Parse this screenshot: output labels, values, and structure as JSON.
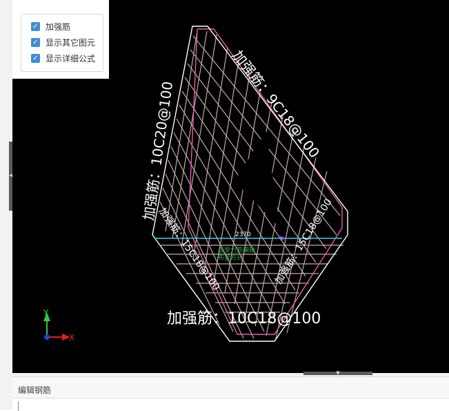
{
  "options_panel": {
    "items": [
      {
        "label": "加强筋",
        "checked": true
      },
      {
        "label": "显示其它图元",
        "checked": true
      },
      {
        "label": "显示详细公式",
        "checked": true
      }
    ]
  },
  "drawing": {
    "labels": {
      "top_right": "加强筋：9C18@100",
      "left": "加强筋：10C20@100",
      "bottom": "加强筋：10C18@100",
      "lower_left": "加强筋：15C18@100",
      "lower_right": "加强筋：15C18@100",
      "dimension": "2370",
      "green_text_1": "板受力筋编辑",
      "green_text_2": "布置方式"
    },
    "axis": {
      "y": "Y",
      "x": "X"
    },
    "colors": {
      "background": "#000000",
      "outline": "#ffffff",
      "rebar_lines": "#c8a9a9",
      "edge_rebar": "#e060b0",
      "dimension_line": "#38d0e8",
      "axis_y": "#2ecc40",
      "axis_x": "#e02020"
    }
  },
  "bottom_panel": {
    "title": "编辑钢筋"
  }
}
